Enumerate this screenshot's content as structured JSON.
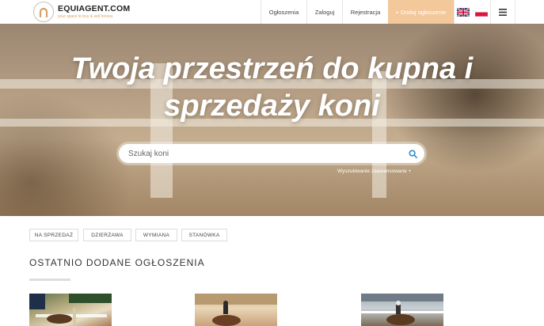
{
  "header": {
    "logo_title": "EQUIAGENT.COM",
    "logo_tagline": "your space to buy & sell horses",
    "nav": {
      "listings": "Ogłoszenia",
      "login": "Zaloguj",
      "register": "Rejestracja",
      "add_listing": "+ Dodaj ogłoszenie"
    },
    "languages": [
      "en",
      "pl"
    ]
  },
  "hero": {
    "title": "Twoja przestrzeń do kupna i sprzedaży koni",
    "search_placeholder": "Szukaj koni",
    "advanced_search": "Wyszukiwanie zaawansowane +"
  },
  "filters": [
    "NA SPRZEDAŻ",
    "DZIERŻAWA",
    "WYMIANA",
    "STANÓWKA"
  ],
  "recent": {
    "title": "OSTATNIO DODANE OGŁOSZENIA"
  },
  "colors": {
    "accent": "#f3c89a",
    "tagline": "#d9a064"
  }
}
